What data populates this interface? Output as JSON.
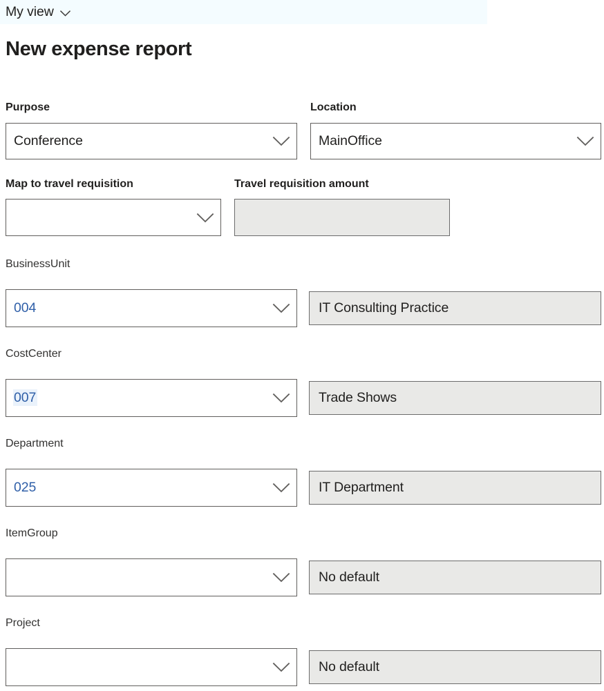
{
  "header": {
    "view_selector_label": "My view",
    "view_selector_icon": "chevron-down-icon",
    "page_title": "New expense report"
  },
  "form": {
    "rows": [
      {
        "id": "purpose",
        "label": "Purpose",
        "value": "Conference",
        "control": "dropdown",
        "icon": "chevron-down-icon",
        "label_emphasis": "bold",
        "value_style": "normal"
      },
      {
        "id": "location",
        "label": "Location",
        "value": "MainOffice",
        "control": "dropdown",
        "icon": "chevron-down-icon",
        "label_emphasis": "bold",
        "value_style": "normal"
      },
      {
        "id": "map-to-travel-requisition",
        "label": "Map to travel requisition",
        "value": "",
        "control": "dropdown",
        "icon": "chevron-down-icon",
        "label_emphasis": "bold",
        "value_style": "normal"
      },
      {
        "id": "travel-requisition-amount",
        "label": "Travel requisition amount",
        "value": "",
        "control": "textbox",
        "state": "disabled",
        "label_emphasis": "bold",
        "value_style": "normal"
      },
      {
        "id": "businessunit",
        "label": "BusinessUnit",
        "value": "004",
        "control": "dropdown",
        "icon": "chevron-down-icon",
        "label_emphasis": "normal",
        "value_style": "link",
        "description": "IT Consulting Practice",
        "description_state": "disabled"
      },
      {
        "id": "costcenter",
        "label": "CostCenter",
        "value": "007",
        "control": "dropdown",
        "icon": "chevron-down-icon",
        "label_emphasis": "normal",
        "value_style": "link-selected",
        "description": "Trade Shows",
        "description_state": "disabled"
      },
      {
        "id": "department",
        "label": "Department",
        "value": "025",
        "control": "dropdown",
        "icon": "chevron-down-icon",
        "label_emphasis": "normal",
        "value_style": "link",
        "description": "IT Department",
        "description_state": "disabled"
      },
      {
        "id": "itemgroup",
        "label": "ItemGroup",
        "value": "",
        "control": "dropdown",
        "icon": "chevron-down-icon",
        "label_emphasis": "normal",
        "value_style": "normal",
        "description": "No default",
        "description_state": "disabled"
      },
      {
        "id": "project",
        "label": "Project",
        "value": "",
        "control": "dropdown",
        "icon": "chevron-down-icon",
        "label_emphasis": "normal",
        "value_style": "normal",
        "description": "No default",
        "description_state": "disabled"
      }
    ]
  },
  "colors": {
    "link": "#2f5fa8",
    "border": "#605e5c",
    "disabled_bg": "#e9e9e7",
    "text": "#201f1e",
    "band": "#f4fcff"
  }
}
